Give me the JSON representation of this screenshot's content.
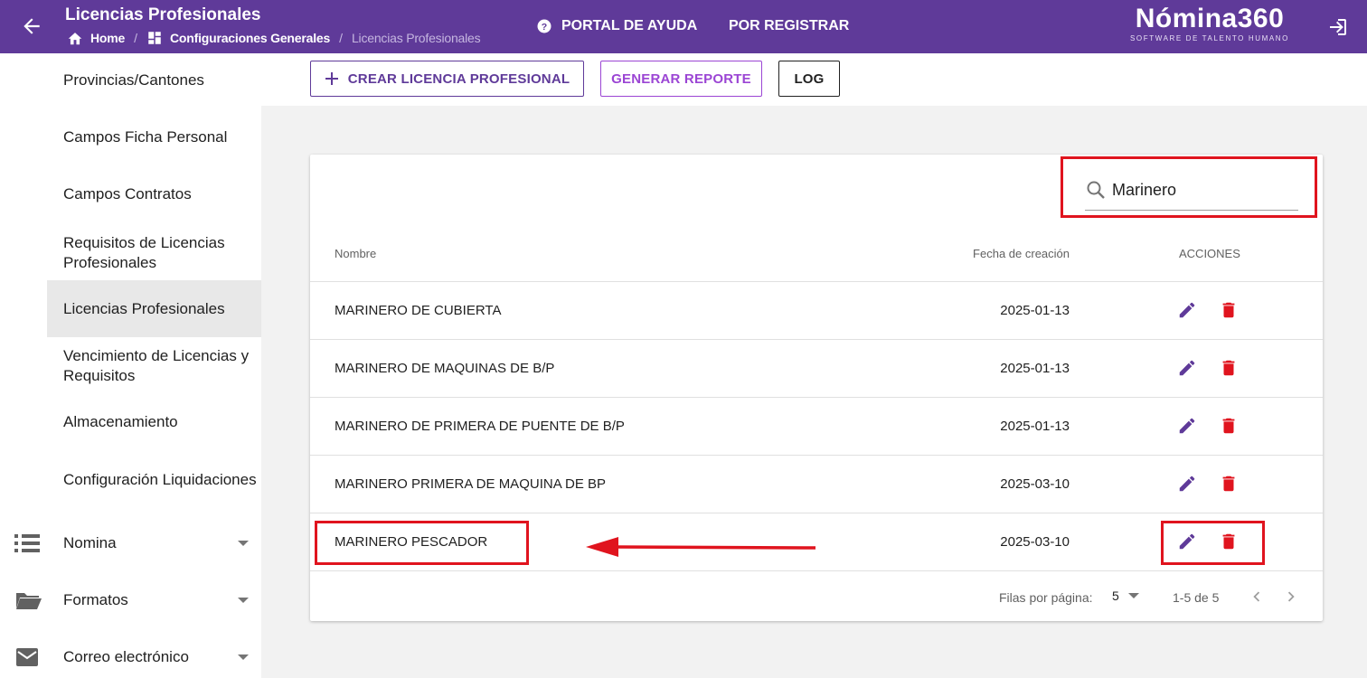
{
  "header": {
    "title": "Licencias Profesionales",
    "breadcrumb": [
      {
        "label": "Home",
        "icon": "home-icon"
      },
      {
        "label": "Configuraciones Generales",
        "icon": "dashboard-icon"
      },
      {
        "label": "Licencias Profesionales"
      }
    ],
    "help_label": "PORTAL DE AYUDA",
    "register_label": "POR REGISTRAR",
    "logo_main": "Nómina360",
    "logo_sub": "SOFTWARE DE TALENTO HUMANO",
    "brand_color": "#5f3a99"
  },
  "sidebar": {
    "items": [
      {
        "label": "Provincias/Cantones"
      },
      {
        "label": "Campos Ficha Personal"
      },
      {
        "label": "Campos Contratos"
      },
      {
        "label": "Requisitos de Licencias Profesionales"
      },
      {
        "label": "Licencias Profesionales",
        "active": true
      },
      {
        "label": "Vencimiento de Licencias y Requisitos"
      },
      {
        "label": "Almacenamiento"
      },
      {
        "label": "Configuración Liquidaciones"
      }
    ],
    "groups": [
      {
        "label": "Nomina",
        "icon": "list-icon"
      },
      {
        "label": "Formatos",
        "icon": "folder-icon"
      },
      {
        "label": "Correo electrónico",
        "icon": "mail-icon"
      }
    ]
  },
  "toolbar": {
    "create_label": "CREAR LICENCIA PROFESIONAL",
    "report_label": "GENERAR REPORTE",
    "log_label": "LOG"
  },
  "search": {
    "value": "Marinero"
  },
  "table": {
    "headers": {
      "name": "Nombre",
      "date": "Fecha de creación",
      "actions": "ACCIONES"
    },
    "rows": [
      {
        "name": "MARINERO DE CUBIERTA",
        "date": "2025-01-13"
      },
      {
        "name": "MARINERO DE MAQUINAS DE B/P",
        "date": "2025-01-13"
      },
      {
        "name": "MARINERO DE PRIMERA DE PUENTE DE B/P",
        "date": "2025-01-13"
      },
      {
        "name": "MARINERO PRIMERA DE MAQUINA DE BP",
        "date": "2025-03-10"
      },
      {
        "name": "MARINERO PESCADOR",
        "date": "2025-03-10"
      }
    ]
  },
  "pagination": {
    "rows_per_page_label": "Filas por página:",
    "rows_per_page": "5",
    "range": "1-5 de 5"
  },
  "colors": {
    "edit": "#5f3a99",
    "delete": "#e0141e",
    "annotation": "#e0141e"
  }
}
